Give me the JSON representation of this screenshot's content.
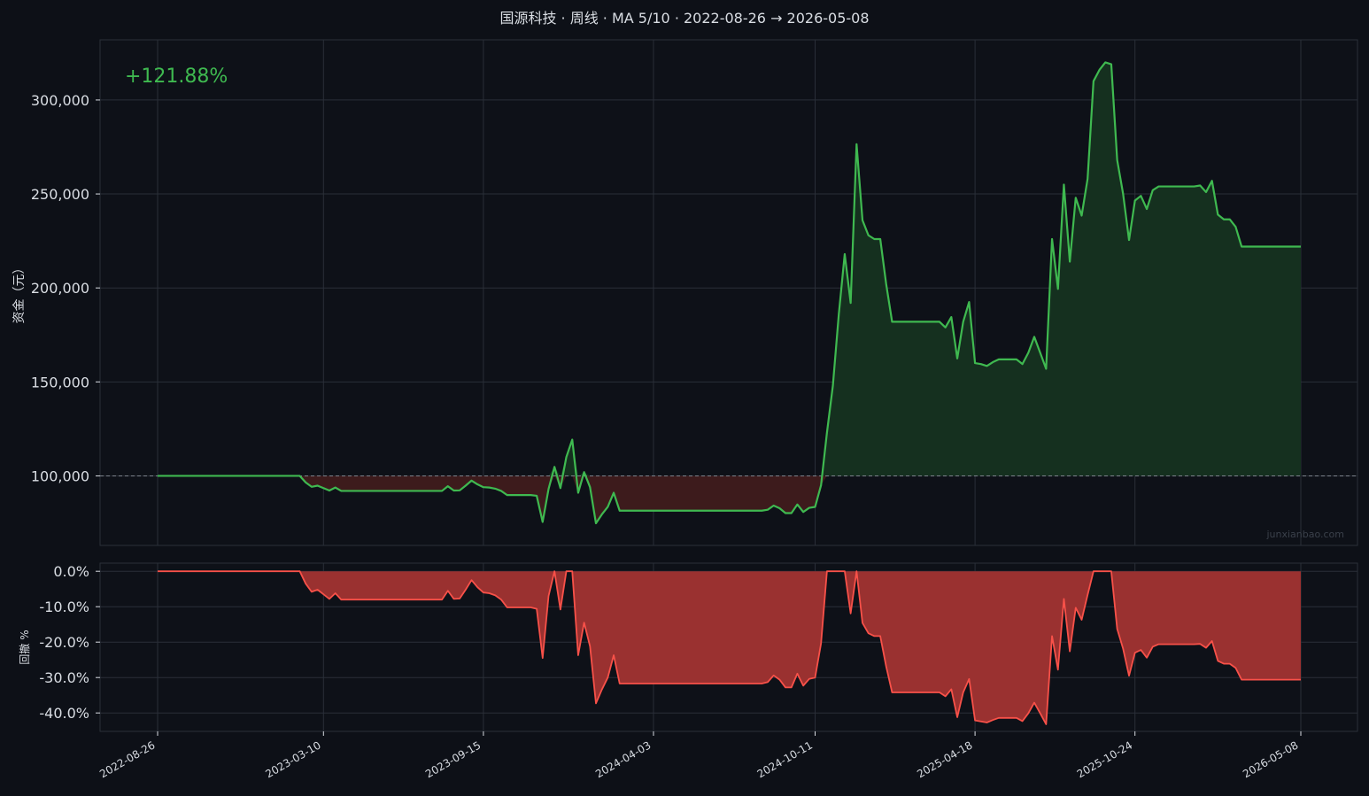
{
  "title": "国源科技 · 周线 · MA 5/10 · 2022-08-26 → 2026-05-08",
  "return_label": "+121.88%",
  "watermark": "junxianbao.com",
  "colors": {
    "background": "#0d1017",
    "plot_background": "#0e1118",
    "grid": "#2a2f38",
    "text": "#d9dde3",
    "equity_line": "#3fb950",
    "gain_fill": "#15301f",
    "loss_fill": "#3d1b1c",
    "drawdown_line": "#f85149",
    "drawdown_fill": "#9a3130",
    "baseline": "#7d838c",
    "watermark": "#3b414b"
  },
  "chart_data": [
    {
      "name": "equity",
      "type": "area",
      "title": "国源科技 · 周线 · MA 5/10 · 2022-08-26 → 2026-05-08",
      "xlabel": "",
      "ylabel": "资金（元）",
      "xlim": [
        "2022-08-26",
        "2026-05-08"
      ],
      "ylim": [
        63000,
        332000
      ],
      "baseline": 100000,
      "yticks": [
        100000,
        150000,
        200000,
        250000,
        300000
      ],
      "ytick_labels": [
        "100,000",
        "150,000",
        "200,000",
        "250,000",
        "300,000"
      ],
      "xticks": [
        "2022-08-26",
        "2023-03-10",
        "2023-09-15",
        "2024-04-03",
        "2024-10-11",
        "2025-04-18",
        "2025-10-24",
        "2026-05-08"
      ],
      "grid": true,
      "series": [
        {
          "name": "",
          "points": [
            [
              "2022-08-26",
              100000
            ],
            [
              "2023-02-10",
              100000
            ],
            [
              "2023-02-17",
              96500
            ],
            [
              "2023-02-24",
              94200
            ],
            [
              "2023-03-03",
              94800
            ],
            [
              "2023-03-10",
              93500
            ],
            [
              "2023-03-17",
              92200
            ],
            [
              "2023-03-24",
              93800
            ],
            [
              "2023-03-31",
              92000
            ],
            [
              "2023-05-26",
              92000
            ],
            [
              "2023-07-28",
              92000
            ],
            [
              "2023-08-04",
              94500
            ],
            [
              "2023-08-11",
              92200
            ],
            [
              "2023-08-18",
              92300
            ],
            [
              "2023-08-25",
              94800
            ],
            [
              "2023-09-01",
              97500
            ],
            [
              "2023-09-08",
              95500
            ],
            [
              "2023-09-15",
              94000
            ],
            [
              "2023-09-22",
              93800
            ],
            [
              "2023-09-29",
              93200
            ],
            [
              "2023-10-06",
              92000
            ],
            [
              "2023-10-13",
              89800
            ],
            [
              "2023-10-20",
              89800
            ],
            [
              "2023-11-10",
              89800
            ],
            [
              "2023-11-17",
              89400
            ],
            [
              "2023-11-24",
              75500
            ],
            [
              "2023-12-01",
              93000
            ],
            [
              "2023-12-08",
              104800
            ],
            [
              "2023-12-15",
              93500
            ],
            [
              "2023-12-22",
              110000
            ],
            [
              "2023-12-29",
              119300
            ],
            [
              "2024-01-05",
              91000
            ],
            [
              "2024-01-12",
              102000
            ],
            [
              "2024-01-19",
              94000
            ],
            [
              "2024-01-26",
              74800
            ],
            [
              "2024-02-02",
              79500
            ],
            [
              "2024-02-09",
              83500
            ],
            [
              "2024-02-16",
              91000
            ],
            [
              "2024-02-23",
              81500
            ],
            [
              "2024-08-09",
              81500
            ],
            [
              "2024-08-16",
              82000
            ],
            [
              "2024-08-23",
              84200
            ],
            [
              "2024-08-30",
              82800
            ],
            [
              "2024-09-06",
              80200
            ],
            [
              "2024-09-13",
              80200
            ],
            [
              "2024-09-20",
              84800
            ],
            [
              "2024-09-27",
              80800
            ],
            [
              "2024-10-04",
              83000
            ],
            [
              "2024-10-11",
              83500
            ],
            [
              "2024-10-18",
              95000
            ],
            [
              "2024-10-25",
              123000
            ],
            [
              "2024-11-01",
              148000
            ],
            [
              "2024-11-08",
              186000
            ],
            [
              "2024-11-15",
              218000
            ],
            [
              "2024-11-22",
              192000
            ],
            [
              "2024-11-29",
              276500
            ],
            [
              "2024-12-06",
              236000
            ],
            [
              "2024-12-13",
              228000
            ],
            [
              "2024-12-20",
              226000
            ],
            [
              "2024-12-27",
              226000
            ],
            [
              "2025-01-03",
              202000
            ],
            [
              "2025-01-10",
              182000
            ],
            [
              "2025-03-07",
              182000
            ],
            [
              "2025-03-14",
              179000
            ],
            [
              "2025-03-21",
              184500
            ],
            [
              "2025-03-28",
              162500
            ],
            [
              "2025-04-04",
              182000
            ],
            [
              "2025-04-11",
              192500
            ],
            [
              "2025-04-18",
              160000
            ],
            [
              "2025-04-25",
              159500
            ],
            [
              "2025-05-02",
              158500
            ],
            [
              "2025-05-09",
              160500
            ],
            [
              "2025-05-16",
              162000
            ],
            [
              "2025-06-06",
              162000
            ],
            [
              "2025-06-13",
              159500
            ],
            [
              "2025-06-20",
              165500
            ],
            [
              "2025-06-27",
              174000
            ],
            [
              "2025-07-04",
              165500
            ],
            [
              "2025-07-11",
              157000
            ],
            [
              "2025-07-18",
              226000
            ],
            [
              "2025-07-25",
              199500
            ],
            [
              "2025-08-01",
              255000
            ],
            [
              "2025-08-08",
              214000
            ],
            [
              "2025-08-15",
              248000
            ],
            [
              "2025-08-22",
              238500
            ],
            [
              "2025-08-29",
              258000
            ],
            [
              "2025-09-05",
              310000
            ],
            [
              "2025-09-12",
              316000
            ],
            [
              "2025-09-19",
              320000
            ],
            [
              "2025-09-26",
              319000
            ],
            [
              "2025-10-03",
              268000
            ],
            [
              "2025-10-10",
              250000
            ],
            [
              "2025-10-17",
              225500
            ],
            [
              "2025-10-24",
              246500
            ],
            [
              "2025-10-31",
              249000
            ],
            [
              "2025-11-07",
              242000
            ],
            [
              "2025-11-14",
              252000
            ],
            [
              "2025-11-21",
              254000
            ],
            [
              "2026-01-02",
              254000
            ],
            [
              "2026-01-09",
              254500
            ],
            [
              "2026-01-16",
              251000
            ],
            [
              "2026-01-23",
              257000
            ],
            [
              "2026-01-30",
              239000
            ],
            [
              "2026-02-06",
              236500
            ],
            [
              "2026-02-13",
              236500
            ],
            [
              "2026-02-20",
              232500
            ],
            [
              "2026-02-27",
              222000
            ],
            [
              "2026-05-08",
              222000
            ]
          ]
        }
      ]
    },
    {
      "name": "drawdown",
      "type": "area",
      "title": "",
      "xlabel": "",
      "ylabel": "回撤 %",
      "xlim": [
        "2022-08-26",
        "2026-05-08"
      ],
      "ylim": [
        -45.2,
        2.3
      ],
      "yticks": [
        0,
        -10,
        -20,
        -30,
        -40
      ],
      "ytick_labels": [
        "0.0%",
        "-10.0%",
        "-20.0%",
        "-30.0%",
        "-40.0%"
      ],
      "xticks": [
        "2022-08-26",
        "2023-03-10",
        "2023-09-15",
        "2024-04-03",
        "2024-10-11",
        "2025-04-18",
        "2025-10-24",
        "2026-05-08"
      ],
      "grid": true,
      "series": [
        {
          "name": "",
          "points": [
            [
              "2022-08-26",
              0
            ],
            [
              "2023-02-10",
              0
            ],
            [
              "2023-02-17",
              -3.5
            ],
            [
              "2023-02-24",
              -5.8
            ],
            [
              "2023-03-03",
              -5.2
            ],
            [
              "2023-03-10",
              -6.5
            ],
            [
              "2023-03-17",
              -7.8
            ],
            [
              "2023-03-24",
              -6.2
            ],
            [
              "2023-03-31",
              -8.0
            ],
            [
              "2023-07-28",
              -8.0
            ],
            [
              "2023-08-04",
              -5.5
            ],
            [
              "2023-08-11",
              -7.8
            ],
            [
              "2023-08-18",
              -7.7
            ],
            [
              "2023-08-25",
              -5.2
            ],
            [
              "2023-09-01",
              -2.5
            ],
            [
              "2023-09-08",
              -4.5
            ],
            [
              "2023-09-15",
              -6.0
            ],
            [
              "2023-09-22",
              -6.2
            ],
            [
              "2023-09-29",
              -6.8
            ],
            [
              "2023-10-06",
              -8.0
            ],
            [
              "2023-10-13",
              -10.2
            ],
            [
              "2023-11-10",
              -10.2
            ],
            [
              "2023-11-17",
              -10.6
            ],
            [
              "2023-11-24",
              -24.5
            ],
            [
              "2023-12-01",
              -7.0
            ],
            [
              "2023-12-08",
              0
            ],
            [
              "2023-12-15",
              -10.8
            ],
            [
              "2023-12-22",
              0
            ],
            [
              "2023-12-29",
              0
            ],
            [
              "2024-01-05",
              -23.7
            ],
            [
              "2024-01-12",
              -14.5
            ],
            [
              "2024-01-19",
              -21.2
            ],
            [
              "2024-01-26",
              -37.3
            ],
            [
              "2024-02-02",
              -33.4
            ],
            [
              "2024-02-09",
              -30.0
            ],
            [
              "2024-02-16",
              -23.7
            ],
            [
              "2024-02-23",
              -31.7
            ],
            [
              "2024-08-09",
              -31.7
            ],
            [
              "2024-08-16",
              -31.3
            ],
            [
              "2024-08-23",
              -29.4
            ],
            [
              "2024-08-30",
              -30.6
            ],
            [
              "2024-09-06",
              -32.8
            ],
            [
              "2024-09-13",
              -32.8
            ],
            [
              "2024-09-20",
              -28.9
            ],
            [
              "2024-09-27",
              -32.3
            ],
            [
              "2024-10-04",
              -30.4
            ],
            [
              "2024-10-11",
              -30.0
            ],
            [
              "2024-10-18",
              -20.4
            ],
            [
              "2024-10-25",
              0
            ],
            [
              "2024-11-15",
              0
            ],
            [
              "2024-11-22",
              -11.9
            ],
            [
              "2024-11-29",
              0
            ],
            [
              "2024-12-06",
              -14.6
            ],
            [
              "2024-12-13",
              -17.5
            ],
            [
              "2024-12-20",
              -18.3
            ],
            [
              "2024-12-27",
              -18.3
            ],
            [
              "2025-01-03",
              -26.9
            ],
            [
              "2025-01-10",
              -34.2
            ],
            [
              "2025-03-07",
              -34.2
            ],
            [
              "2025-03-14",
              -35.3
            ],
            [
              "2025-03-21",
              -33.3
            ],
            [
              "2025-03-28",
              -41.2
            ],
            [
              "2025-04-04",
              -34.2
            ],
            [
              "2025-04-11",
              -30.4
            ],
            [
              "2025-04-18",
              -42.1
            ],
            [
              "2025-05-02",
              -42.7
            ],
            [
              "2025-05-09",
              -42.0
            ],
            [
              "2025-05-16",
              -41.4
            ],
            [
              "2025-06-06",
              -41.4
            ],
            [
              "2025-06-13",
              -42.3
            ],
            [
              "2025-06-20",
              -40.1
            ],
            [
              "2025-06-27",
              -37.1
            ],
            [
              "2025-07-04",
              -40.1
            ],
            [
              "2025-07-11",
              -43.2
            ],
            [
              "2025-07-18",
              -18.3
            ],
            [
              "2025-07-25",
              -27.8
            ],
            [
              "2025-08-01",
              -7.8
            ],
            [
              "2025-08-08",
              -22.6
            ],
            [
              "2025-08-15",
              -10.3
            ],
            [
              "2025-08-22",
              -13.7
            ],
            [
              "2025-08-29",
              -6.7
            ],
            [
              "2025-09-05",
              0
            ],
            [
              "2025-09-26",
              0
            ],
            [
              "2025-10-03",
              -16.3
            ],
            [
              "2025-10-10",
              -21.9
            ],
            [
              "2025-10-17",
              -29.5
            ],
            [
              "2025-10-24",
              -23.0
            ],
            [
              "2025-10-31",
              -22.2
            ],
            [
              "2025-11-07",
              -24.4
            ],
            [
              "2025-11-14",
              -21.3
            ],
            [
              "2025-11-21",
              -20.6
            ],
            [
              "2026-01-02",
              -20.6
            ],
            [
              "2026-01-09",
              -20.5
            ],
            [
              "2026-01-16",
              -21.6
            ],
            [
              "2026-01-23",
              -19.7
            ],
            [
              "2026-01-30",
              -25.3
            ],
            [
              "2026-02-06",
              -26.1
            ],
            [
              "2026-02-13",
              -26.1
            ],
            [
              "2026-02-20",
              -27.3
            ],
            [
              "2026-02-27",
              -30.6
            ],
            [
              "2026-05-08",
              -30.6
            ]
          ]
        }
      ]
    }
  ]
}
